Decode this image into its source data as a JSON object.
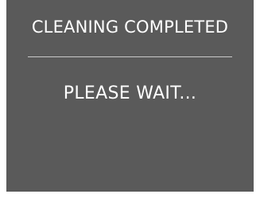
{
  "screen": {
    "title": "CLEANING COMPLETED",
    "message": "PLEASE WAIT...",
    "background_color": "#5a5a5a",
    "text_color": "#ffffff"
  }
}
